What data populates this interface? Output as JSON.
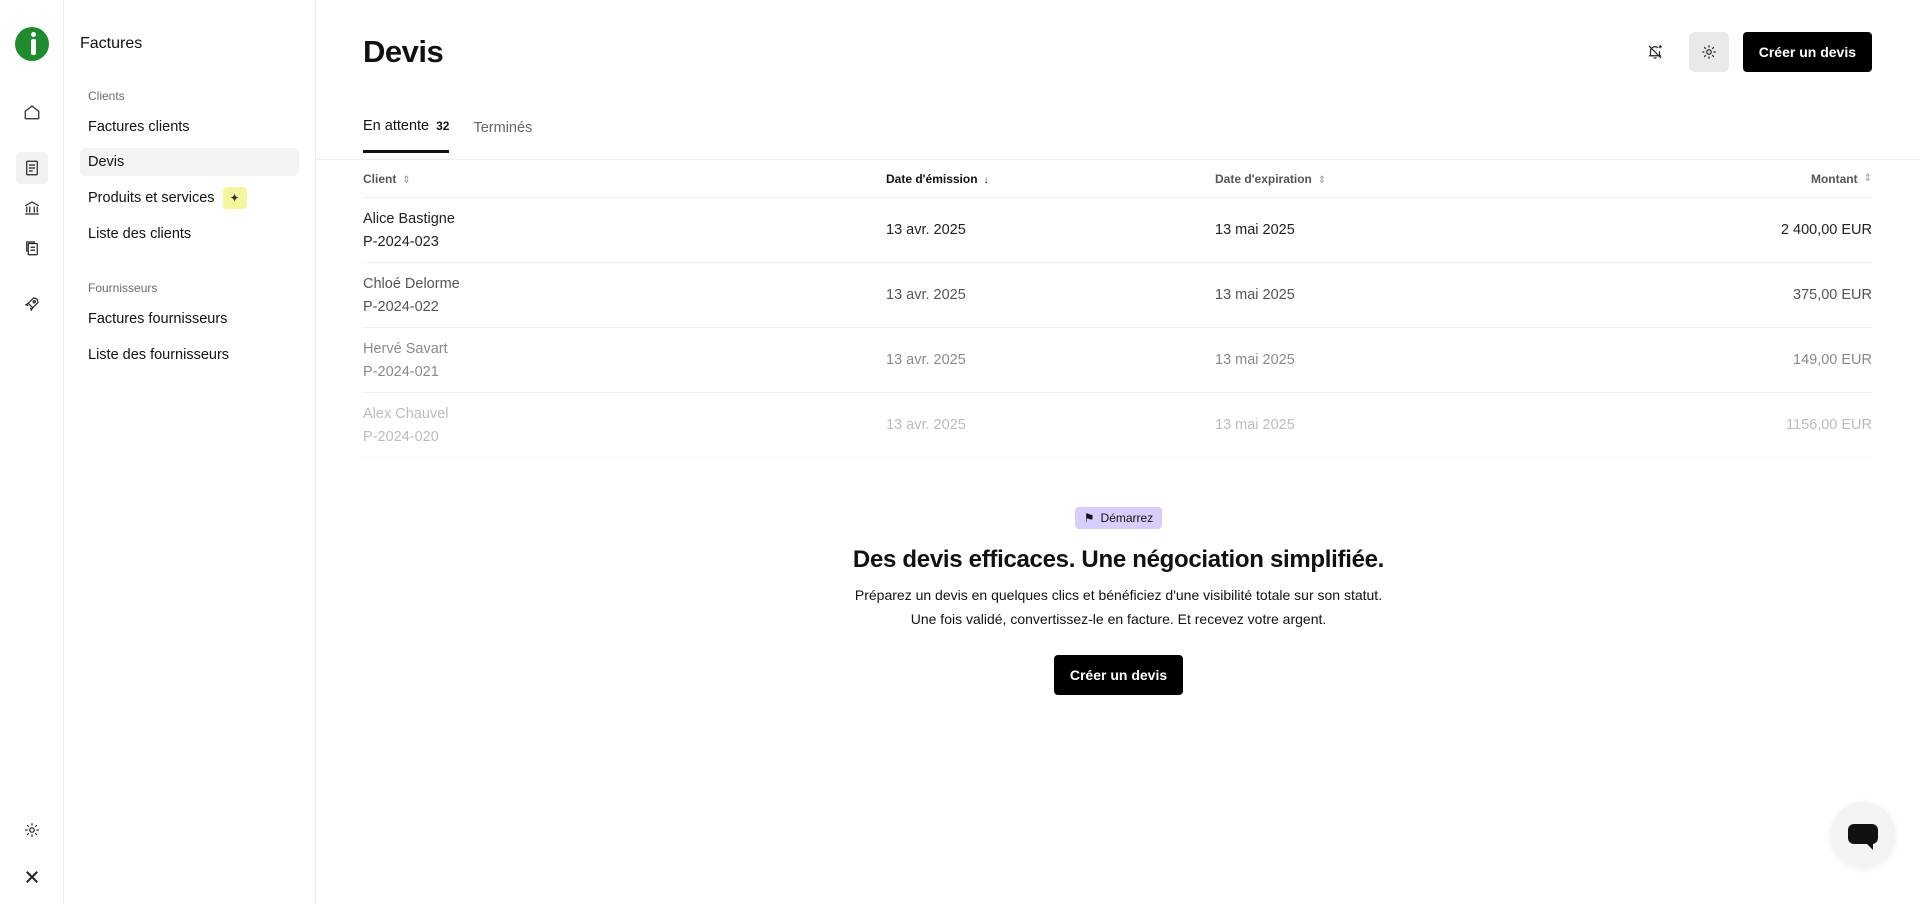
{
  "rail": {
    "items": [
      {
        "icon": "home-icon"
      },
      {
        "icon": "invoice-icon"
      },
      {
        "icon": "bank-icon"
      },
      {
        "icon": "documents-icon"
      },
      {
        "icon": "rocket-icon"
      },
      {
        "icon": "gear-icon"
      },
      {
        "icon": "x-logo-icon"
      }
    ]
  },
  "sidebar": {
    "title": "Factures",
    "sections": [
      {
        "label": "Clients",
        "items": [
          {
            "label": "Factures clients"
          },
          {
            "label": "Devis"
          },
          {
            "label": "Produits et services"
          },
          {
            "label": "Liste des clients"
          }
        ]
      },
      {
        "label": "Fournisseurs",
        "items": [
          {
            "label": "Factures fournisseurs"
          },
          {
            "label": "Liste des fournisseurs"
          }
        ]
      }
    ]
  },
  "header": {
    "title": "Devis",
    "create_label": "Créer un devis"
  },
  "tabs": [
    {
      "label": "En attente",
      "count": "32"
    },
    {
      "label": "Terminés"
    }
  ],
  "table": {
    "columns": [
      "Client",
      "Date d'émission",
      "Date d'expiration",
      "Montant"
    ],
    "rows": [
      {
        "client": "Alice Bastigne",
        "ref": "P-2024-023",
        "emission": "13 avr. 2025",
        "expiration": "13 mai 2025",
        "amount": "2 400,00 EUR"
      },
      {
        "client": "Chloé Delorme",
        "ref": "P-2024-022",
        "emission": "13 avr. 2025",
        "expiration": "13 mai 2025",
        "amount": "375,00 EUR"
      },
      {
        "client": "Hervé Savart",
        "ref": "P-2024-021",
        "emission": "13 avr. 2025",
        "expiration": "13 mai 2025",
        "amount": "149,00 EUR"
      },
      {
        "client": "Alex Chauvel",
        "ref": "P-2024-020",
        "emission": "13 avr. 2025",
        "expiration": "13 mai 2025",
        "amount": "1156,00 EUR"
      }
    ]
  },
  "empty_state": {
    "badge": "Démarrez",
    "title": "Des devis efficaces. Une négociation simplifiée.",
    "line1": "Préparez un devis en quelques clics et bénéficiez d'une visibilité totale sur son statut.",
    "line2": "Une fois validé, convertissez-le en facture. Et recevez votre argent.",
    "cta": "Créer un devis"
  },
  "colors": {
    "accent": "#000000",
    "badge_bg": "#d8cdfc",
    "logo": "#1f8a2e",
    "new_badge": "#f5f5a0"
  }
}
